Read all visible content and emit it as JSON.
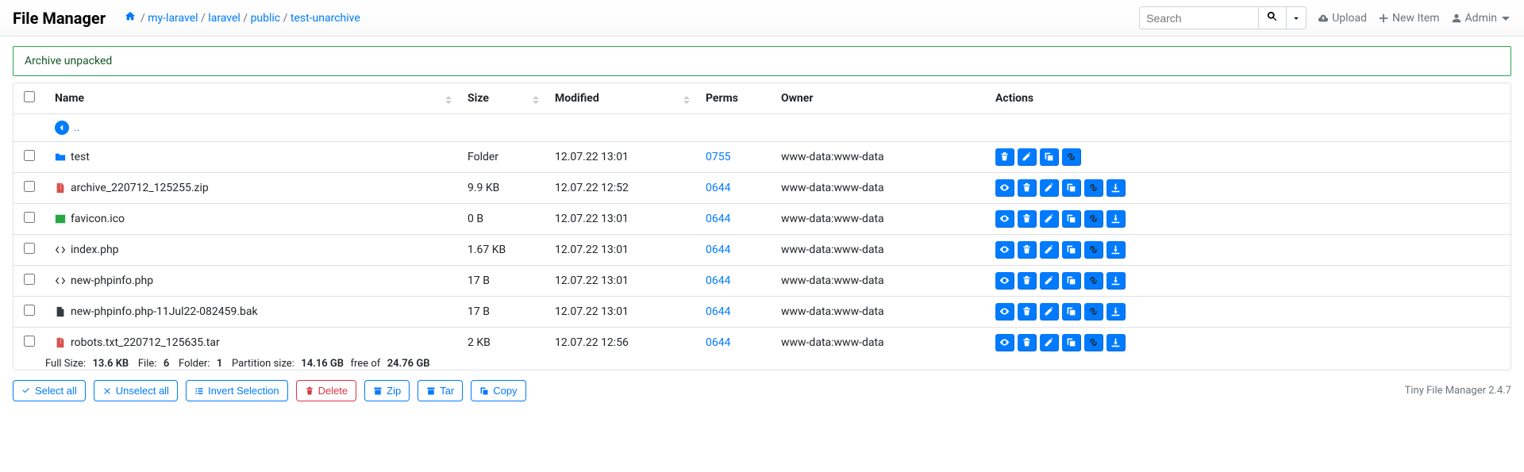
{
  "brand": "File Manager",
  "breadcrumb": [
    "my-laravel",
    "laravel",
    "public",
    "test-unarchive"
  ],
  "search": {
    "placeholder": "Search"
  },
  "nav": {
    "upload": "Upload",
    "new_item": "New Item",
    "admin": "Admin"
  },
  "alert": "Archive unpacked",
  "columns": {
    "name": "Name",
    "size": "Size",
    "modified": "Modified",
    "perms": "Perms",
    "owner": "Owner",
    "actions": "Actions"
  },
  "parent_label": "..",
  "rows": [
    {
      "icon": "folder",
      "name": "test",
      "size": "Folder",
      "modified": "12.07.22 13:01",
      "perms": "0755",
      "owner": "www-data:www-data",
      "actions": [
        "delete",
        "rename",
        "copy",
        "link"
      ]
    },
    {
      "icon": "zip",
      "name": "archive_220712_125255.zip",
      "size": "9.9 KB",
      "modified": "12.07.22 12:52",
      "perms": "0644",
      "owner": "www-data:www-data",
      "actions": [
        "view",
        "delete",
        "rename",
        "copy",
        "link",
        "download"
      ]
    },
    {
      "icon": "image",
      "name": "favicon.ico",
      "size": "0 B",
      "modified": "12.07.22 13:01",
      "perms": "0644",
      "owner": "www-data:www-data",
      "actions": [
        "view",
        "delete",
        "rename",
        "copy",
        "link",
        "download"
      ]
    },
    {
      "icon": "code",
      "name": "index.php",
      "size": "1.67 KB",
      "modified": "12.07.22 13:01",
      "perms": "0644",
      "owner": "www-data:www-data",
      "actions": [
        "view",
        "delete",
        "rename",
        "copy",
        "link",
        "download"
      ]
    },
    {
      "icon": "code",
      "name": "new-phpinfo.php",
      "size": "17 B",
      "modified": "12.07.22 13:01",
      "perms": "0644",
      "owner": "www-data:www-data",
      "actions": [
        "view",
        "delete",
        "rename",
        "copy",
        "link",
        "download"
      ]
    },
    {
      "icon": "file",
      "name": "new-phpinfo.php-11Jul22-082459.bak",
      "size": "17 B",
      "modified": "12.07.22 13:01",
      "perms": "0644",
      "owner": "www-data:www-data",
      "actions": [
        "view",
        "delete",
        "rename",
        "copy",
        "link",
        "download"
      ]
    },
    {
      "icon": "zip",
      "name": "robots.txt_220712_125635.tar",
      "size": "2 KB",
      "modified": "12.07.22 12:56",
      "perms": "0644",
      "owner": "www-data:www-data",
      "actions": [
        "view",
        "delete",
        "rename",
        "copy",
        "link",
        "download"
      ]
    }
  ],
  "footer": {
    "full_size_label": "Full Size:",
    "full_size": "13.6 KB",
    "file_label": "File:",
    "file_count": "6",
    "folder_label": "Folder:",
    "folder_count": "1",
    "partition_label": "Partition size:",
    "partition_used": "14.16 GB",
    "free_of": "free of",
    "partition_total": "24.76 GB"
  },
  "buttons": {
    "select_all": "Select all",
    "unselect_all": "Unselect all",
    "invert": "Invert Selection",
    "delete": "Delete",
    "zip": "Zip",
    "tar": "Tar",
    "copy": "Copy"
  },
  "app_footer": "Tiny File Manager 2.4.7"
}
